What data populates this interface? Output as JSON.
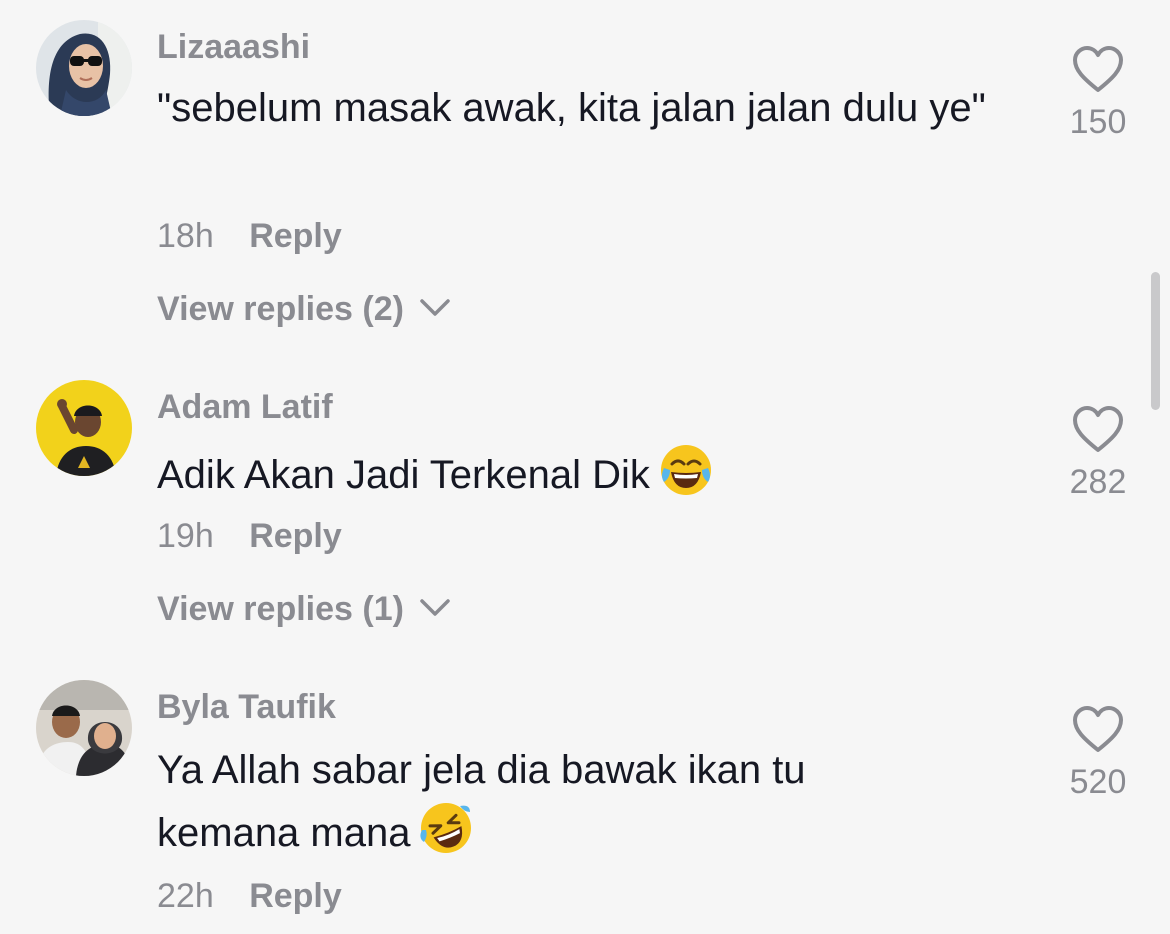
{
  "comments": [
    {
      "username": "Lizaaashi",
      "text": "\"sebelum masak awak, kita jalan jalan dulu ye\"",
      "time": "18h",
      "reply_label": "Reply",
      "view_replies": "View replies (2)",
      "likes": "150",
      "avatar": "avatar-hijab-sunglasses"
    },
    {
      "username": "Adam Latif",
      "text": "Adik Akan Jadi Terkenal Dik",
      "emoji": "face-with-tears-of-joy",
      "time": "19h",
      "reply_label": "Reply",
      "view_replies": "View replies (1)",
      "likes": "282",
      "avatar": "avatar-man-yellow-background"
    },
    {
      "username": "Byla Taufik",
      "text": "Ya Allah sabar jela dia bawak ikan tu kemana mana",
      "emoji": "rolling-on-the-floor-laughing",
      "time": "22h",
      "reply_label": "Reply",
      "likes": "520",
      "avatar": "avatar-couple"
    }
  ],
  "icons": {
    "like": "heart-outline-icon",
    "expand": "chevron-down-icon"
  },
  "colors": {
    "background": "#f6f6f6",
    "text": "#161823",
    "secondary_text": "#8a8b91"
  }
}
